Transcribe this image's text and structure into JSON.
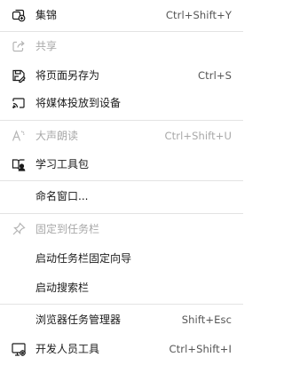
{
  "menu": {
    "items": [
      {
        "label": "集锦",
        "shortcut": "Ctrl+Shift+Y",
        "icon": "collections-icon"
      },
      {
        "label": "共享",
        "shortcut": "",
        "icon": "share-icon"
      },
      {
        "label": "将页面另存为",
        "shortcut": "Ctrl+S",
        "icon": "save-page-icon"
      },
      {
        "label": "将媒体投放到设备",
        "shortcut": "",
        "icon": "cast-icon"
      },
      {
        "label": "大声朗读",
        "shortcut": "Ctrl+Shift+U",
        "icon": "read-aloud-icon"
      },
      {
        "label": "学习工具包",
        "shortcut": "",
        "icon": "learning-toolkit-icon"
      },
      {
        "label": "命名窗口...",
        "shortcut": ""
      },
      {
        "label": "固定到任务栏",
        "shortcut": "",
        "icon": "pin-icon"
      },
      {
        "label": "启动任务栏固定向导",
        "shortcut": ""
      },
      {
        "label": "启动搜索栏",
        "shortcut": ""
      },
      {
        "label": "浏览器任务管理器",
        "shortcut": "Shift+Esc"
      },
      {
        "label": "开发人员工具",
        "shortcut": "Ctrl+Shift+I",
        "icon": "developer-tools-icon"
      }
    ]
  },
  "colors": {
    "text": "#1a1a1a",
    "disabled_text": "#a8a8a8",
    "shortcut_text": "#555555",
    "separator": "#e3e3e3",
    "background": "#ffffff"
  }
}
